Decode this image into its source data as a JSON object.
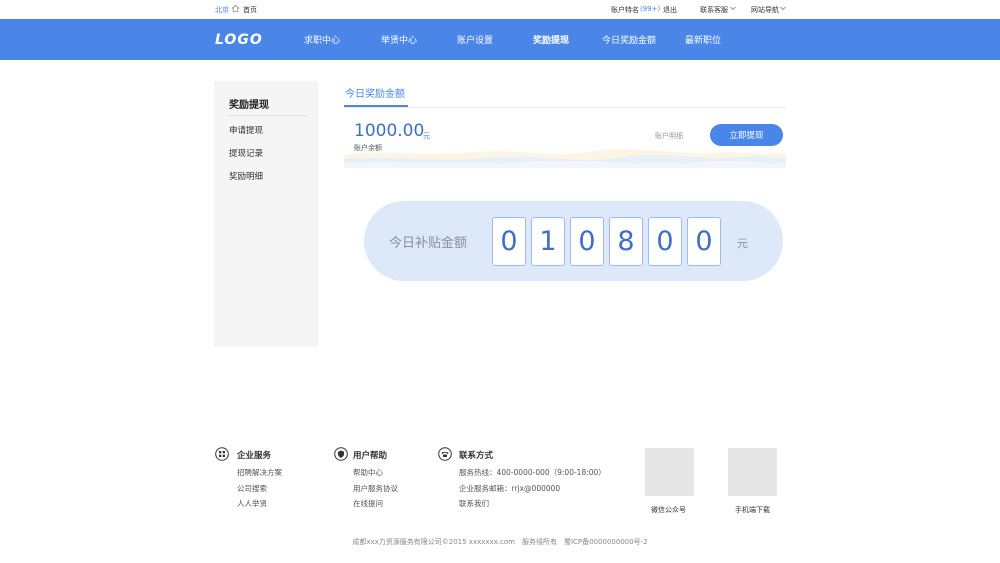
{
  "topbar": {
    "location": "北京",
    "home": "首页",
    "username": "账户特名",
    "messages": "(99+)",
    "logout": "退出",
    "service": "联系客服",
    "site_nav": "网站导航"
  },
  "nav": {
    "logo": "LOGO",
    "items": [
      "求职中心",
      "举贤中心",
      "账户设置",
      "奖励提现",
      "今日奖励金额",
      "最新职位"
    ],
    "active": "奖励提现"
  },
  "sidebar": {
    "title": "奖励提现",
    "items": [
      "申请提现",
      "提现记录",
      "奖励明细"
    ]
  },
  "main": {
    "tab": "今日奖励金额",
    "balance_amount": "1000.00",
    "balance_unit": "元",
    "balance_label": "账户余额",
    "detail_link": "账户明细",
    "withdraw_button": "立即提现",
    "subsidy_label": "今日补贴金额",
    "subsidy_digits": [
      "0",
      "1",
      "0",
      "8",
      "0",
      "0"
    ],
    "subsidy_unit": "元"
  },
  "footer": {
    "enterprise": {
      "title": "企业服务",
      "links": [
        "招聘解决方案",
        "公司搜索",
        "人人举贤"
      ]
    },
    "help": {
      "title": "用户帮助",
      "links": [
        "帮助中心",
        "用户服务协议",
        "在线提问"
      ]
    },
    "contact": {
      "title": "联系方式",
      "lines": [
        "服务热线：400-0000-000（9:00-18:00）",
        "企业服务邮箱：rrjx@000000",
        "联系我们"
      ]
    },
    "qr_wechat": "微信公众号",
    "qr_app": "手机端下载",
    "copyright": "成都xxx力资源服务有限公司©2015 xxxxxxx.com　服务侵所有　蜀ICP备0000000000号-2"
  },
  "colors": {
    "brand": "#4a86e8",
    "sidebar_bg": "#f5f5f5",
    "subsidy_bg": "#dde8f9"
  }
}
